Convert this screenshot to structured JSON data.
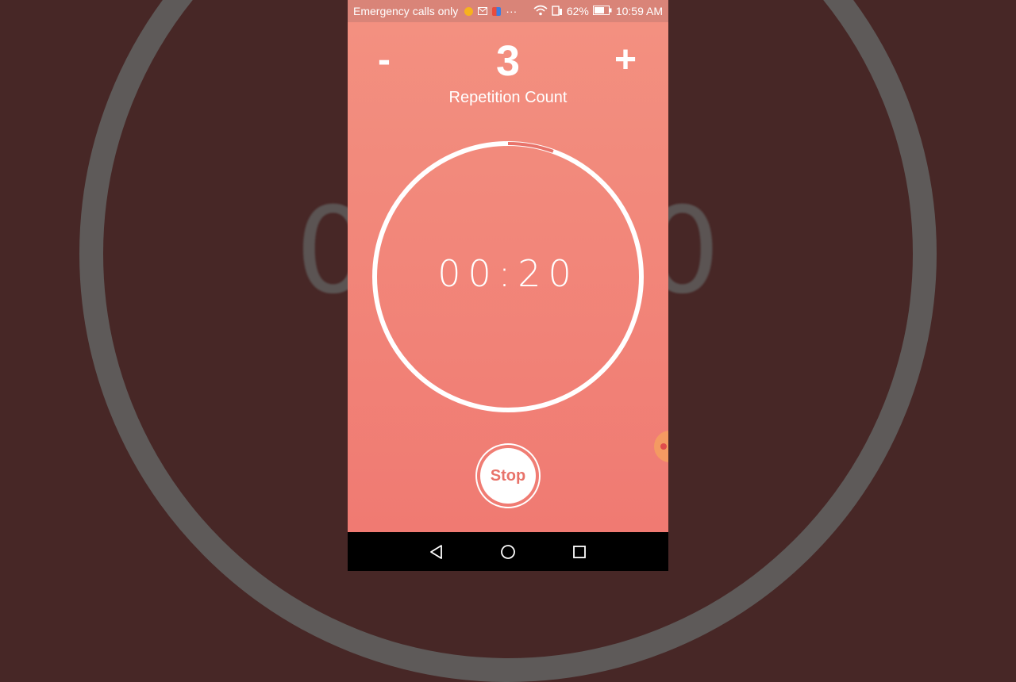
{
  "status_bar": {
    "carrier": "Emergency calls only",
    "dots": "···",
    "battery": "62%",
    "time": "10:59 AM"
  },
  "repetition": {
    "minus_label": "-",
    "plus_label": "+",
    "count": "3",
    "label": "Repetition Count"
  },
  "timer": {
    "time": "00:20",
    "progress_fraction": 0.055
  },
  "controls": {
    "stop_label": "Stop"
  },
  "colors": {
    "app_top": "#f39080",
    "app_bottom": "#f07a72",
    "accent": "#e8736a",
    "background": "#472726"
  },
  "icons": [
    "mail-icon",
    "app-notification-icon",
    "wifi-icon",
    "sim-icon",
    "battery-icon",
    "back-icon",
    "home-icon",
    "recents-icon"
  ]
}
